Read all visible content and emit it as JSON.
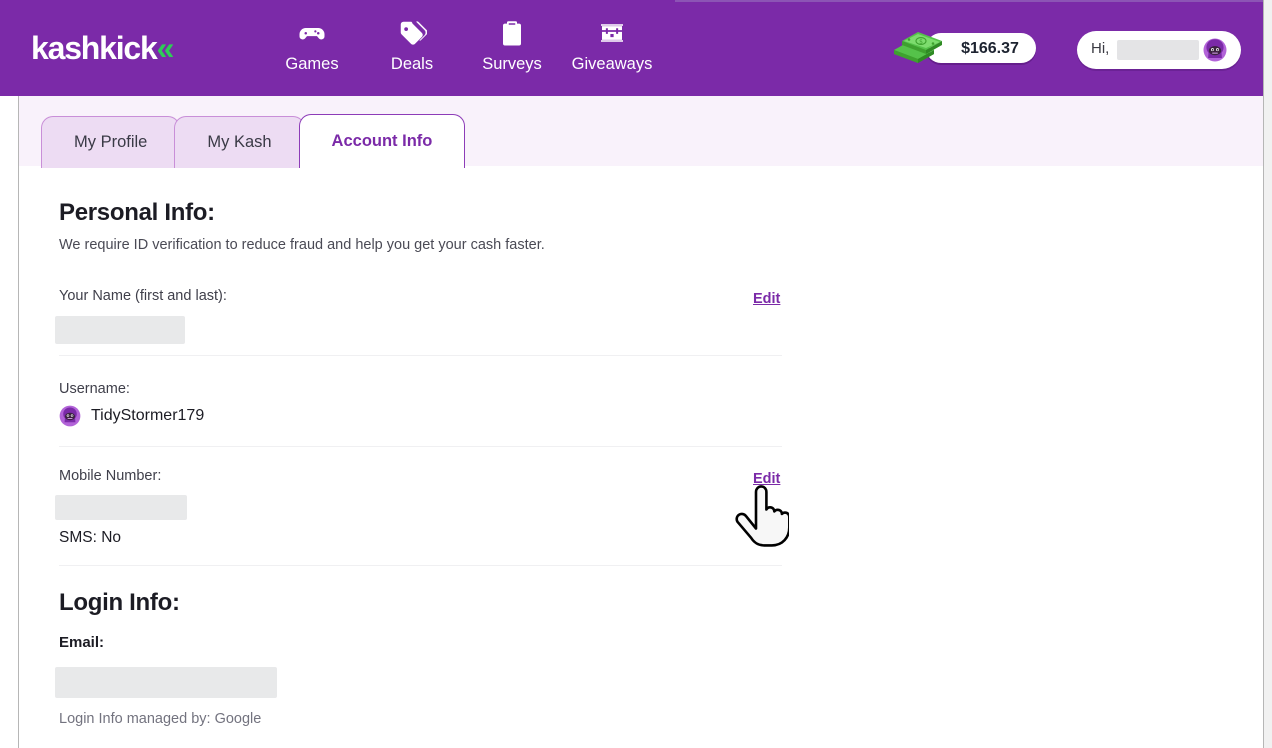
{
  "brand": {
    "logo_text": "kashkick",
    "logo_chevron": "«",
    "purple": "#7b2aa8",
    "green": "#2ecc57",
    "link_purple": "#7b2aa8"
  },
  "header": {
    "nav": [
      {
        "label": "Games",
        "icon": "gamepad-icon"
      },
      {
        "label": "Deals",
        "icon": "tag-icon"
      },
      {
        "label": "Surveys",
        "icon": "clipboard-icon"
      },
      {
        "label": "Giveaways",
        "icon": "treasure-chest-icon"
      }
    ],
    "balance": "$166.37",
    "balance_icon": "cash-stack-icon",
    "greeting": "Hi,",
    "greeting_name_redacted": "",
    "avatar_icon": "user-avatar-icon"
  },
  "tabs": [
    {
      "label": "My Profile",
      "active": false
    },
    {
      "label": "My Kash",
      "active": false
    },
    {
      "label": "Account Info",
      "active": true
    }
  ],
  "personal_info": {
    "heading": "Personal Info:",
    "note": "We require ID verification to reduce fraud and help you get your cash faster.",
    "name_label": "Your Name (first and last):",
    "name_value_redacted": "",
    "name_edit_label": "Edit",
    "username_label": "Username:",
    "username_value": "TidyStormer179",
    "username_avatar_icon": "user-avatar-icon",
    "mobile_label": "Mobile Number:",
    "mobile_value_redacted": "",
    "mobile_edit_label": "Edit",
    "sms_label": "SMS:",
    "sms_value": "No",
    "sms_line": "SMS: No"
  },
  "login_info": {
    "heading": "Login Info:",
    "email_label": "Email:",
    "email_value_redacted": "",
    "managed_by": "Login Info managed by: Google"
  },
  "cursor": {
    "icon": "pointer-hand-cursor"
  }
}
